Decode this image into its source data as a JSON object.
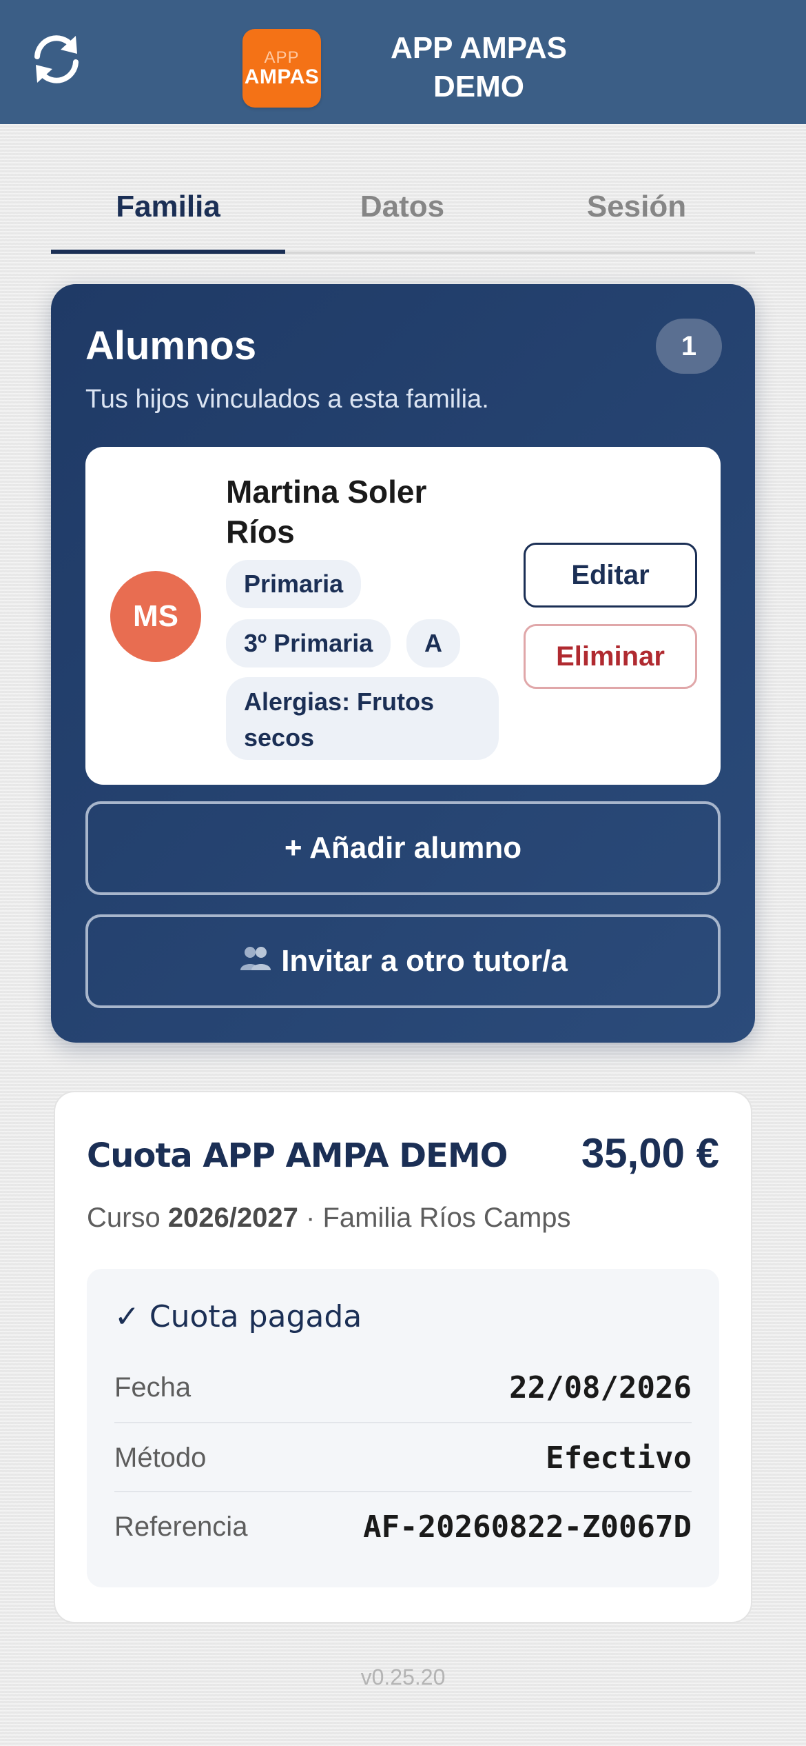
{
  "header": {
    "logo_line1": "APP",
    "logo_line2": "AMPAS",
    "title": "APP AMPAS DEMO",
    "refresh_icon": "refresh-icon",
    "bg_color": "#3b5e86"
  },
  "tabs": [
    {
      "label": "Familia",
      "active": true
    },
    {
      "label": "Datos",
      "active": false
    },
    {
      "label": "Sesión",
      "active": false
    }
  ],
  "alumnos": {
    "title": "Alumnos",
    "count": "1",
    "subtitle": "Tus hijos vinculados a esta familia.",
    "students": [
      {
        "initials": "MS",
        "name": "Martina Soler Ríos",
        "level": "Primaria",
        "course": "3º Primaria",
        "group": "A",
        "allergies": "Alergias: Frutos secos",
        "edit_label": "Editar",
        "delete_label": "Eliminar"
      }
    ],
    "add_label": "+ Añadir alumno",
    "invite_label": "Invitar a otro tutor/a",
    "invite_icon": "people-icon"
  },
  "cuota": {
    "title": "Cuota APP AMPA DEMO",
    "amount": "35,00 €",
    "course_prefix": "Curso ",
    "course_value": "2026/2027",
    "course_suffix": " · Familia Ríos Camps",
    "status": "✓ Cuota pagada",
    "rows": [
      {
        "key": "Fecha",
        "value": "22/08/2026"
      },
      {
        "key": "Método",
        "value": "Efectivo"
      },
      {
        "key": "Referencia",
        "value": "AF-20260822-Z0067D"
      }
    ]
  },
  "footer": {
    "version": "v0.25.20"
  },
  "colors": {
    "primary": "#1b2f55",
    "accent": "#f47216",
    "avatar": "#e86d51",
    "danger": "#b02a30"
  }
}
